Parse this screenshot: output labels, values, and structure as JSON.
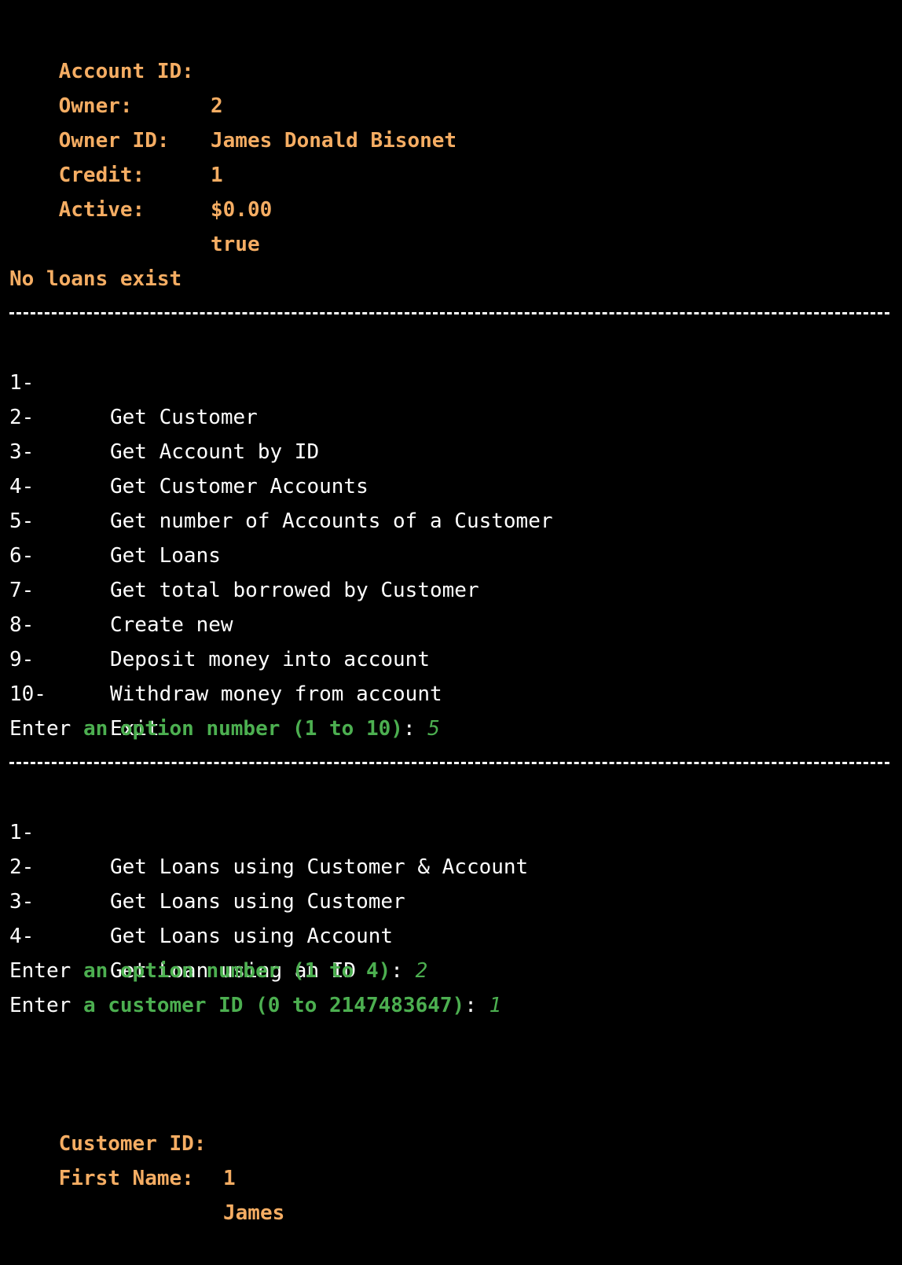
{
  "account": {
    "rows": [
      {
        "label": "Account ID:",
        "value": "2"
      },
      {
        "label": "Owner:",
        "value": "James Donald Bisonet"
      },
      {
        "label": "Owner ID:",
        "value": "1"
      },
      {
        "label": "Credit:",
        "value": "$0.00"
      },
      {
        "label": "Active:",
        "value": "true"
      }
    ]
  },
  "no_loans": "No loans exist",
  "main_menu": {
    "items": [
      {
        "num": "1-",
        "label": "Get Customer"
      },
      {
        "num": "2-",
        "label": "Get Account by ID"
      },
      {
        "num": "3-",
        "label": "Get Customer Accounts"
      },
      {
        "num": "4-",
        "label": "Get number of Accounts of a Customer"
      },
      {
        "num": "5-",
        "label": "Get Loans"
      },
      {
        "num": "6-",
        "label": "Get total borrowed by Customer"
      },
      {
        "num": "7-",
        "label": "Create new"
      },
      {
        "num": "8-",
        "label": "Deposit money into account"
      },
      {
        "num": "9-",
        "label": "Withdraw money from account"
      },
      {
        "num": "10-",
        "label": "Exit"
      }
    ],
    "prompt": {
      "prefix": "Enter",
      "text": "an option number (1 to 10)",
      "colon": ":",
      "input": "5"
    }
  },
  "loan_menu": {
    "items": [
      {
        "num": "1-",
        "label": "Get Loans using Customer & Account"
      },
      {
        "num": "2-",
        "label": "Get Loans using Customer"
      },
      {
        "num": "3-",
        "label": "Get Loans using Account"
      },
      {
        "num": "4-",
        "label": "Get Loan using an ID"
      }
    ],
    "prompt": {
      "prefix": "Enter",
      "text": "an option number (1 to 4)",
      "colon": ":",
      "input": "2"
    },
    "prompt2": {
      "prefix": "Enter",
      "text": "a customer ID (0 to 2147483647)",
      "colon": ":",
      "input": "1"
    }
  },
  "customer": {
    "rows": [
      {
        "label": "Customer ID:",
        "value": "1"
      },
      {
        "label": "First Name:",
        "value": "James"
      }
    ]
  },
  "colors": {
    "background": "#000000",
    "label_orange": "#f5ad63",
    "prompt_green": "#4caf50",
    "text_white": "#ffffff"
  }
}
